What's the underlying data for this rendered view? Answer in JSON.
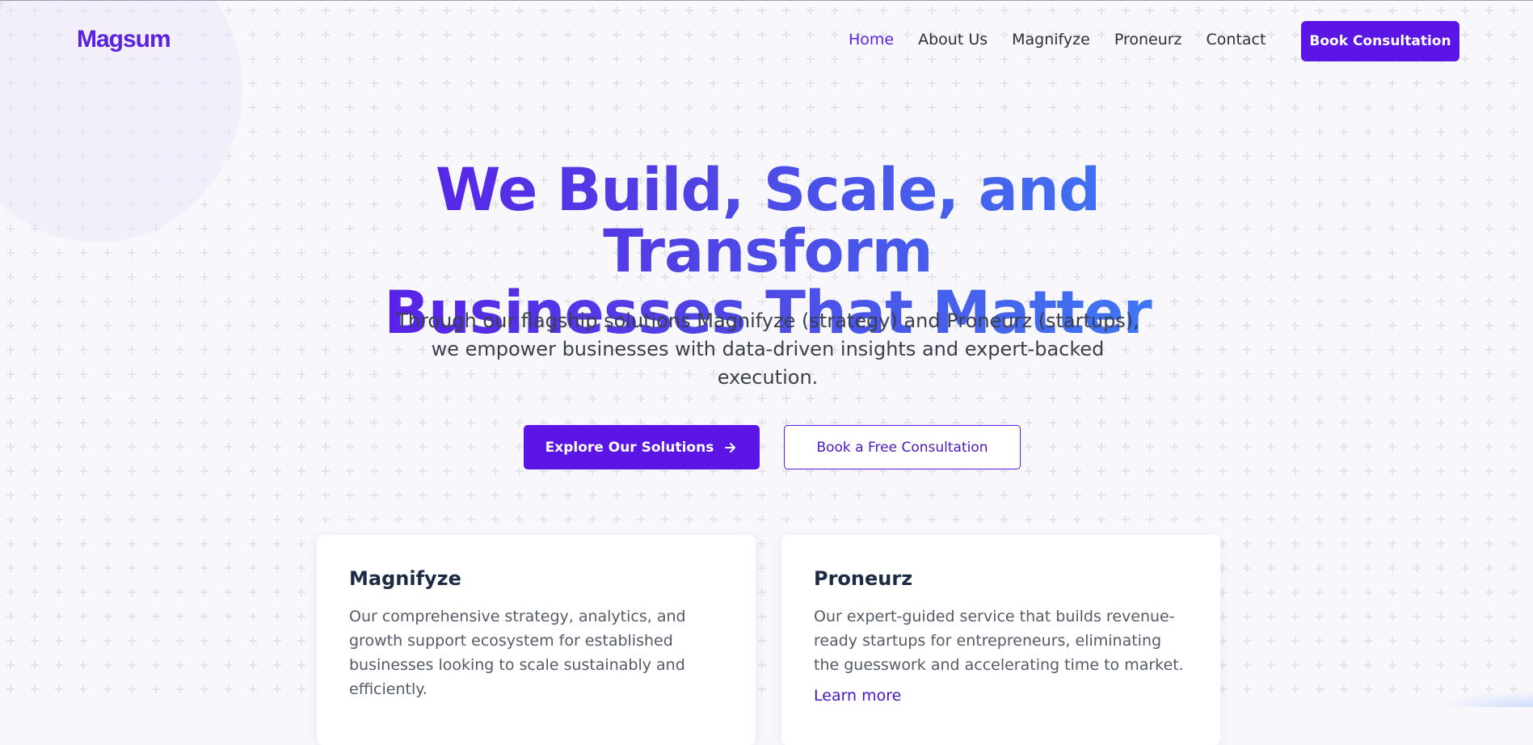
{
  "header": {
    "logo": "Magsum",
    "nav": [
      {
        "label": "Home",
        "active": true
      },
      {
        "label": "About Us"
      },
      {
        "label": "Magnifyze"
      },
      {
        "label": "Proneurz"
      },
      {
        "label": "Contact"
      }
    ],
    "cta": "Book Consultation"
  },
  "hero": {
    "title_line1": "We Build, Scale, and Transform",
    "title_line2": "Businesses That Matter",
    "subtitle": "Through our flagship solutions Magnifyze (strategy) and Proneurz (startups), we empower businesses with data-driven insights and expert-backed execution.",
    "primary_button": "Explore Our Solutions",
    "secondary_button": "Book a Free Consultation"
  },
  "cards": [
    {
      "title": "Magnifyze",
      "description": "Our comprehensive strategy, analytics, and growth support ecosystem for established businesses looking to scale sustainably and efficiently."
    },
    {
      "title": "Proneurz",
      "description": "Our expert-guided service that builds revenue-ready startups for entrepreneurs, eliminating the guesswork and accelerating time to market.",
      "link": "Learn more"
    }
  ],
  "colors": {
    "brand": "#5b16e6",
    "gradient_end": "#3b82f6",
    "text_dark": "#1c2a44",
    "text_body": "#545b68"
  }
}
